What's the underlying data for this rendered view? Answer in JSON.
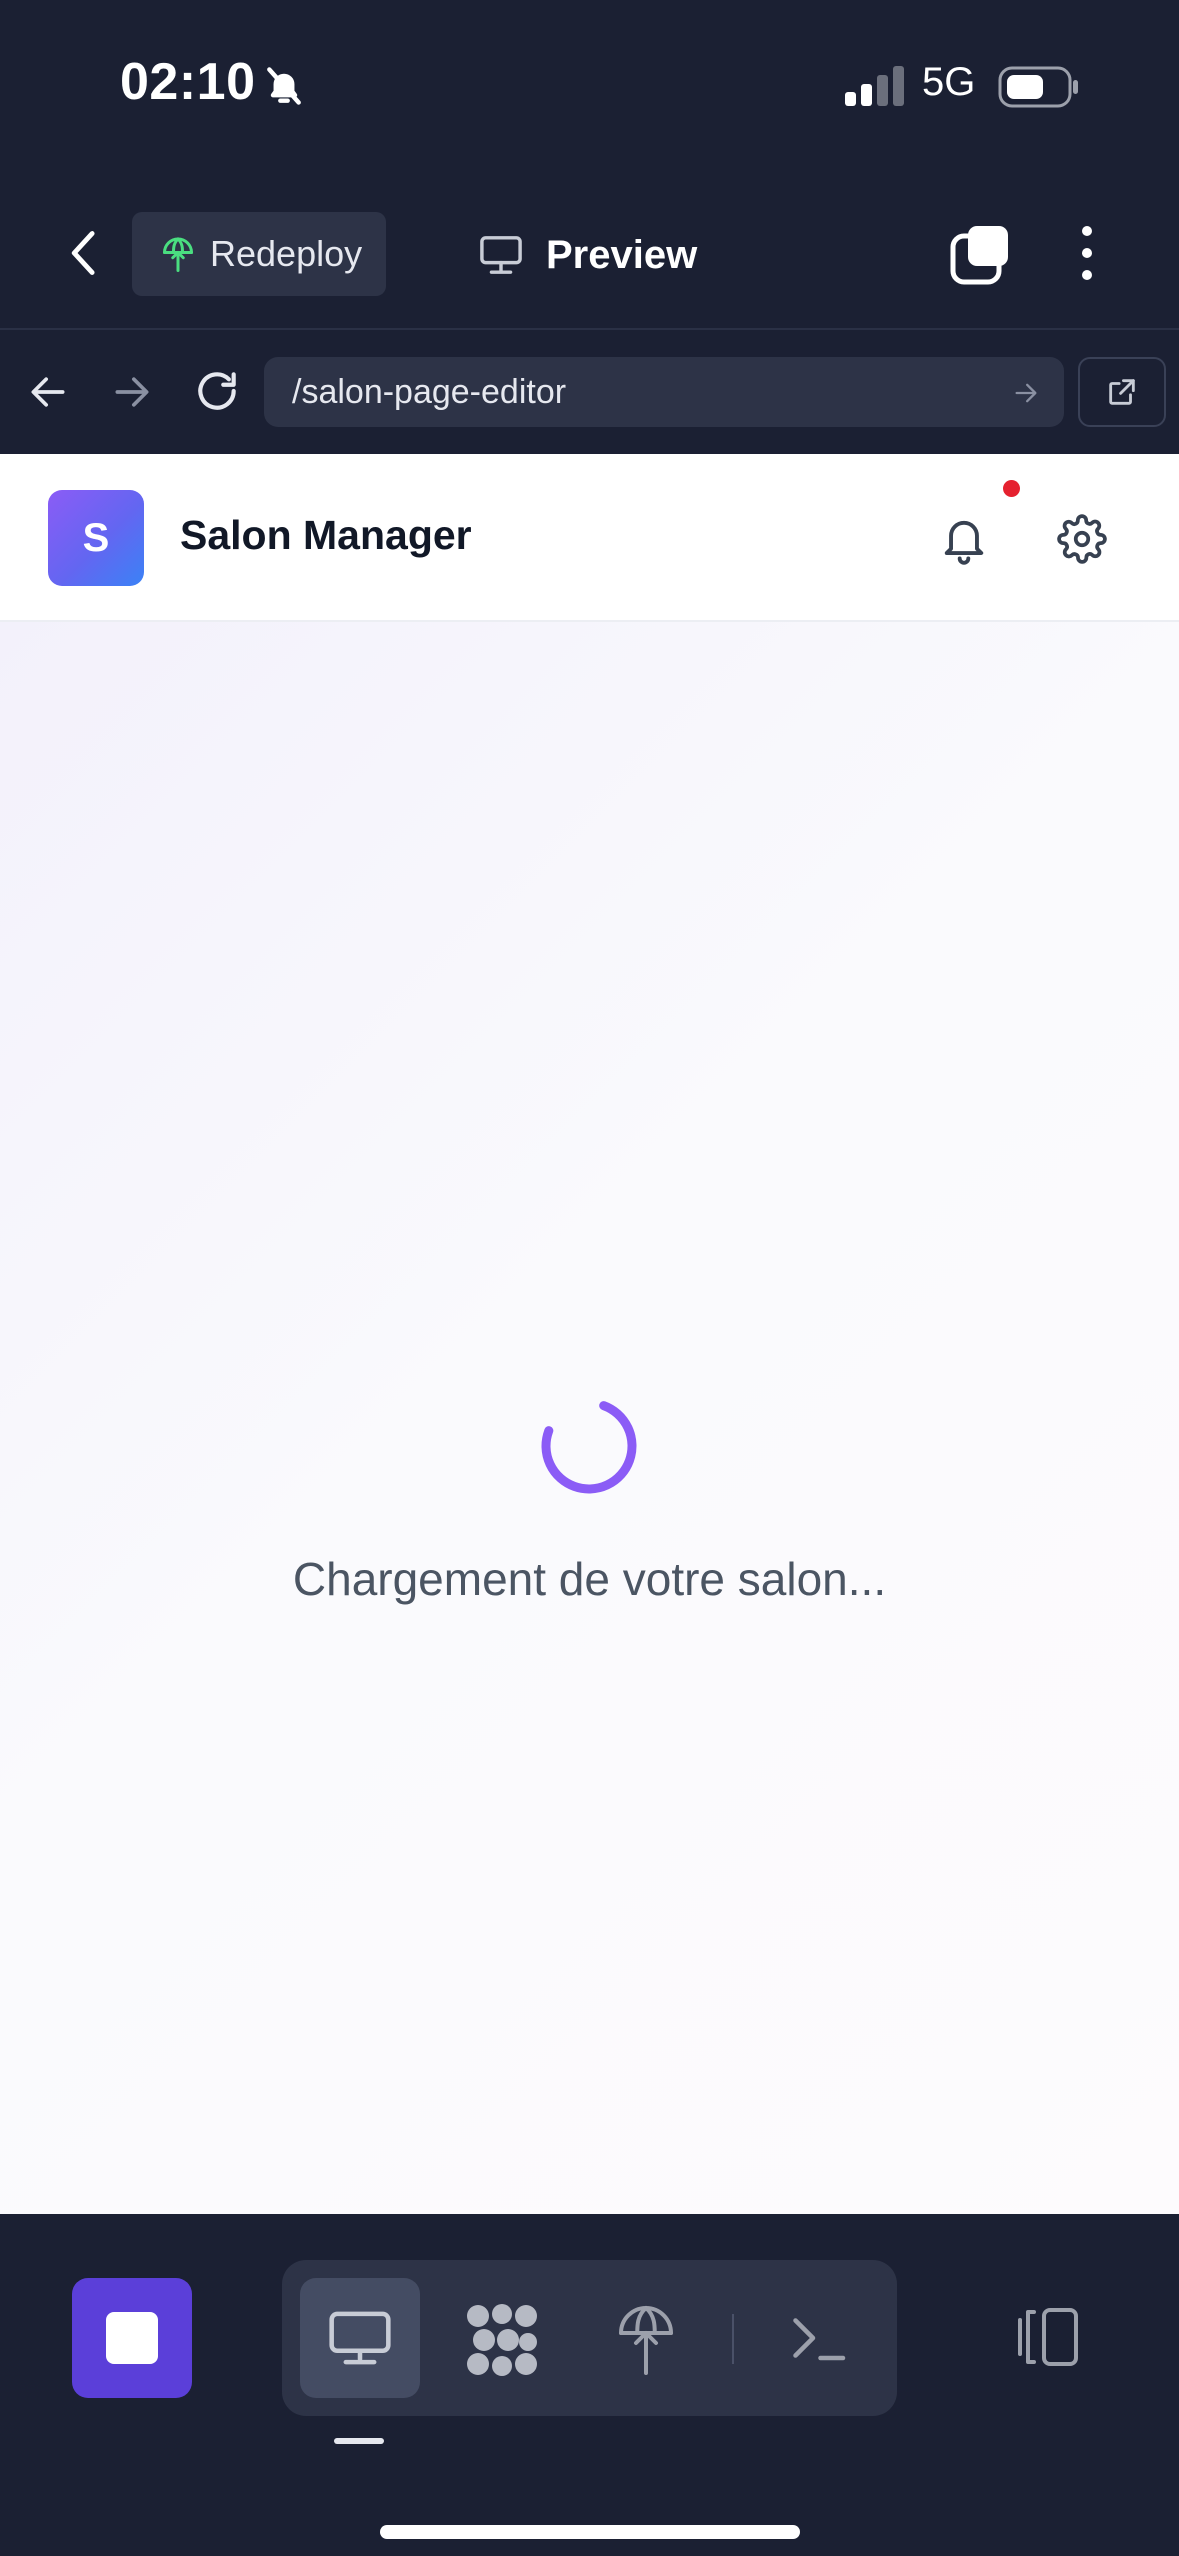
{
  "status_bar": {
    "time": "02:10",
    "network": "5G",
    "icons": [
      "bell-slash-icon",
      "signal-icon",
      "battery-icon"
    ]
  },
  "toolbar": {
    "redeploy_label": "Redeploy",
    "preview_label": "Preview",
    "icons": [
      "chevron-left-icon",
      "globe-upload-icon",
      "monitor-icon",
      "tabs-icon",
      "more-vertical-icon"
    ]
  },
  "browser": {
    "url": "/salon-page-editor",
    "icons": [
      "arrow-left-icon",
      "arrow-right-icon",
      "reload-icon",
      "go-arrow-icon",
      "external-link-icon"
    ]
  },
  "app": {
    "logo_letter": "S",
    "title": "Salon Manager",
    "icons": [
      "bell-icon",
      "gear-icon"
    ],
    "notification_dot_color": "#e5212f",
    "accent": "#8b5cf6"
  },
  "main": {
    "loading_text": "Chargement de votre salon..."
  },
  "dock": {
    "stop_color": "#5b3fd9",
    "icons": [
      "stop-icon",
      "monitor-icon",
      "apps-grid-icon",
      "deploy-icon",
      "terminal-icon",
      "panel-toggle-icon"
    ],
    "active_tab": "monitor"
  }
}
